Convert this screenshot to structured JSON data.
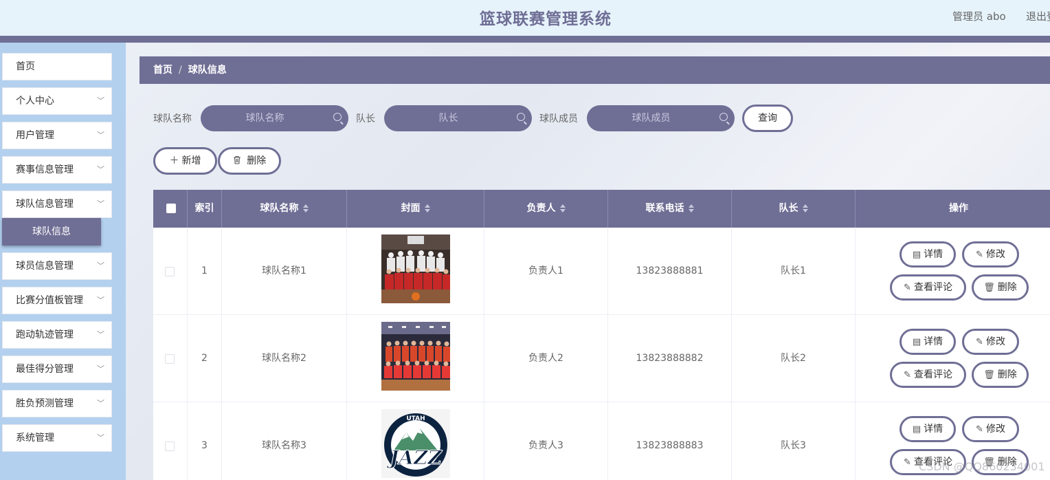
{
  "header": {
    "title": "篮球联赛管理系统",
    "admin": "管理员 abo",
    "logout": "退出登录"
  },
  "sidebar": {
    "items": [
      {
        "label": "首页",
        "has_children": false
      },
      {
        "label": "个人中心",
        "has_children": true
      },
      {
        "label": "用户管理",
        "has_children": true
      },
      {
        "label": "赛事信息管理",
        "has_children": true
      },
      {
        "label": "球队信息管理",
        "has_children": true
      },
      {
        "label": "球员信息管理",
        "has_children": true
      },
      {
        "label": "比赛分值板管理",
        "has_children": true
      },
      {
        "label": "跑动轨迹管理",
        "has_children": true
      },
      {
        "label": "最佳得分管理",
        "has_children": true
      },
      {
        "label": "胜负预测管理",
        "has_children": true
      },
      {
        "label": "系统管理",
        "has_children": true
      }
    ],
    "active_subitem": "球队信息"
  },
  "breadcrumb": {
    "home": "首页",
    "separator": "/",
    "current": "球队信息"
  },
  "search": {
    "team_name": {
      "label": "球队名称",
      "placeholder": "球队名称"
    },
    "captain": {
      "label": "队长",
      "placeholder": "队长"
    },
    "members": {
      "label": "球队成员",
      "placeholder": "球队成员"
    },
    "query_button": "查询"
  },
  "actions": {
    "add": "新增",
    "delete": "删除",
    "add_icon": "plus-icon",
    "delete_icon": "trash-icon"
  },
  "table": {
    "columns": [
      "索引",
      "球队名称",
      "封面",
      "负责人",
      "联系电话",
      "队长",
      "操作"
    ],
    "rows": [
      {
        "index": "1",
        "team_name": "球队名称1",
        "cover": "team-photo-red",
        "manager": "负责人1",
        "phone": "13823888881",
        "captain": "队长1"
      },
      {
        "index": "2",
        "team_name": "球队名称2",
        "cover": "team-photo-court",
        "manager": "负责人2",
        "phone": "13823888882",
        "captain": "队长2"
      },
      {
        "index": "3",
        "team_name": "球队名称3",
        "cover": "utah-jazz-logo",
        "manager": "负责人3",
        "phone": "13823888883",
        "captain": "队长3"
      }
    ],
    "row_actions": {
      "detail": "详情",
      "edit": "修改",
      "comments": "查看评论",
      "delete": "删除"
    }
  },
  "logo_text": {
    "utah": "UTAH",
    "jazz": "JAZZ"
  },
  "watermark": "CSDN @QQ860234001",
  "colors": {
    "accent": "#6f6e95",
    "sidebar_bg": "#b3d0ee",
    "header_bg": "#e6f3fb"
  }
}
